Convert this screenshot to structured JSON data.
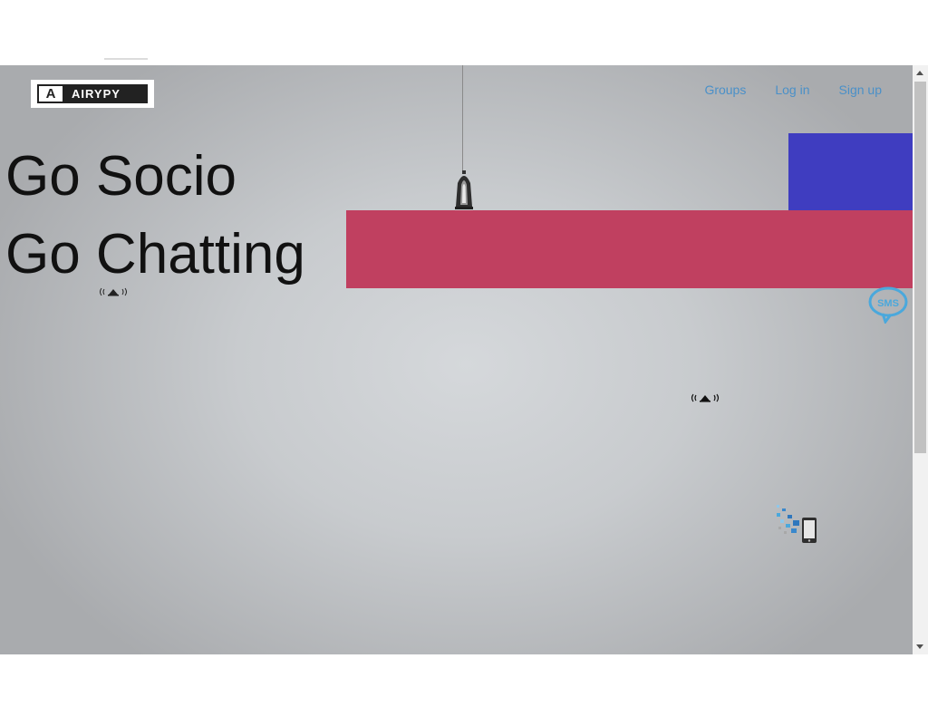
{
  "brand": {
    "name": "AIRYPY",
    "mark": "A"
  },
  "nav": {
    "items": [
      {
        "label": "Groups"
      },
      {
        "label": "Log in"
      },
      {
        "label": "Sign up"
      }
    ]
  },
  "hero": {
    "line1": "Go Socio",
    "line2": "Go Chatting"
  },
  "decor": {
    "sms_bubble_text": "SMS",
    "colors": {
      "blue_block": "#3f3dc0",
      "red_block": "#c04060",
      "link": "#4a90c8"
    },
    "icons": [
      "broadcast-icon",
      "lamp-icon",
      "sms-bubble-icon",
      "phone-message-icon"
    ]
  }
}
